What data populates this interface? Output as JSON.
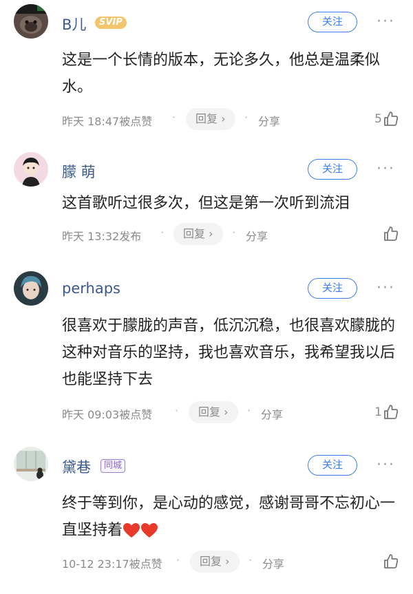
{
  "comments": [
    {
      "user": "B儿",
      "badge": "SVIP",
      "follow_label": "关注",
      "more": "···",
      "text": "这是一个长情的版本，无论多久，他总是温柔似水。",
      "time": "昨天 18:47被点赞",
      "reply_label": "回复 ›",
      "share_label": "分享",
      "likes": "5"
    },
    {
      "user": "朦 萌",
      "follow_label": "关注",
      "more": "···",
      "text": "这首歌听过很多次，但这是第一次听到流泪",
      "time": "昨天 13:32发布",
      "reply_label": "回复 ›",
      "share_label": "分享",
      "likes": ""
    },
    {
      "user": "perhaps",
      "follow_label": "关注",
      "more": "···",
      "text": "很喜欢于朦胧的声音，低沉沉稳，也很喜欢朦胧的这种对音乐的坚持，我也喜欢音乐，我希望我以后也能坚持下去",
      "time": "昨天 09:03被点赞",
      "reply_label": "回复 ›",
      "share_label": "分享",
      "likes": "1"
    },
    {
      "user": "黛巷",
      "badge": "同城",
      "follow_label": "关注",
      "more": "···",
      "text": "终于等到你，是心动的感觉，感谢哥哥不忘初心一直坚持着",
      "time": "10-12 23:17被点赞",
      "reply_label": "回复 ›",
      "share_label": "分享",
      "likes": ""
    }
  ],
  "colors": {
    "username": "#3b5a8c",
    "follow": "#3d7cf0",
    "meta": "#8a8a8a",
    "heart": "#e8392b"
  },
  "icons": {
    "like": "thumbs-up-icon",
    "more": "more-dots-icon",
    "heart": "heart-emoji-icon"
  }
}
